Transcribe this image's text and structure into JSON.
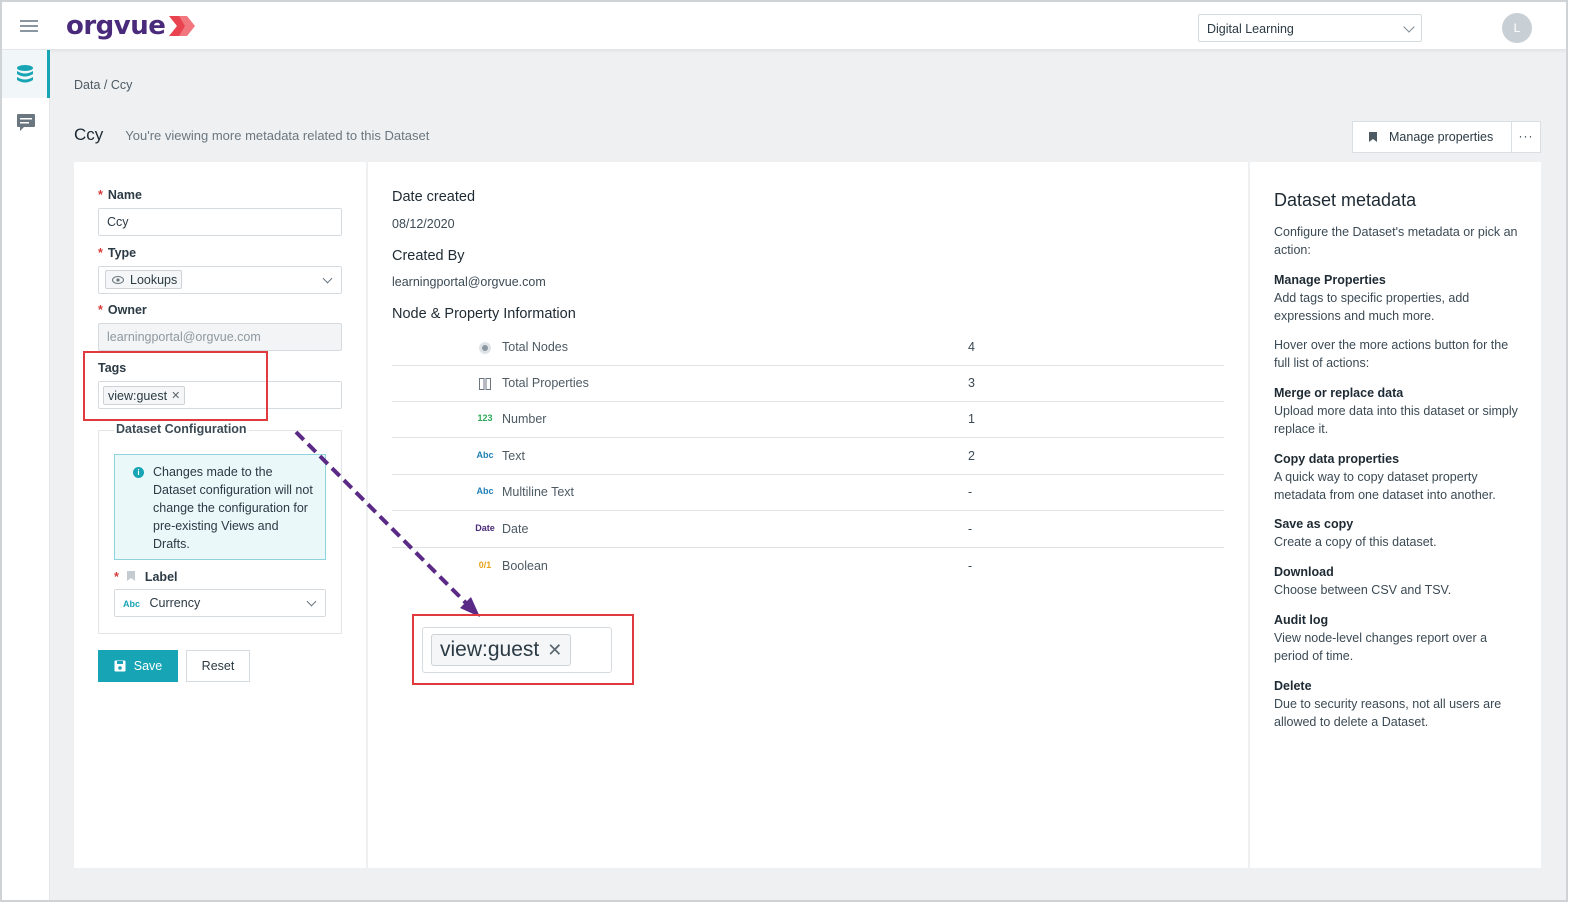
{
  "app": {
    "brand": "orgvue",
    "workspace": "Digital Learning",
    "avatar_initial": "L"
  },
  "breadcrumb": "Data / Ccy",
  "page": {
    "title": "Ccy",
    "subtitle": "You're viewing more metadata related to this Dataset"
  },
  "actions": {
    "manage_properties": "Manage properties",
    "more": "···"
  },
  "form": {
    "name_label": "Name",
    "name_value": "Ccy",
    "type_label": "Type",
    "type_value": "Lookups",
    "owner_label": "Owner",
    "owner_value": "learningportal@orgvue.com",
    "tags_label": "Tags",
    "tag_value": "view:guest",
    "ds_config_title": "Dataset Configuration",
    "info_text": "Changes made to the Dataset configuration will not change the configuration for pre-existing Views and Drafts.",
    "label_label": "Label",
    "label_type": "Abc",
    "label_value": "Currency",
    "save": "Save",
    "reset": "Reset"
  },
  "details": {
    "date_created_label": "Date created",
    "date_created": "08/12/2020",
    "created_by_label": "Created By",
    "created_by": "learningportal@orgvue.com",
    "node_info_label": "Node & Property Information",
    "rows": [
      {
        "icon": "node-icon",
        "name": "Total Nodes",
        "value": "4"
      },
      {
        "icon": "columns-icon",
        "name": "Total Properties",
        "value": "3"
      },
      {
        "icon": "number-type-icon",
        "icon_text": "123",
        "name": "Number",
        "value": "1"
      },
      {
        "icon": "text-type-icon",
        "icon_text": "Abc",
        "name": "Text",
        "value": "2"
      },
      {
        "icon": "multiline-text-type-icon",
        "icon_text": "Abc",
        "name": "Multiline Text",
        "value": "-"
      },
      {
        "icon": "date-type-icon",
        "icon_text": "Date",
        "name": "Date",
        "value": "-"
      },
      {
        "icon": "boolean-type-icon",
        "icon_text": "0/1",
        "name": "Boolean",
        "value": "-"
      }
    ]
  },
  "help": {
    "title": "Dataset metadata",
    "intro": "Configure the Dataset's metadata or pick an action:",
    "items": [
      {
        "heading": "Manage Properties",
        "text": "Add tags to specific properties, add expressions and much more."
      },
      {
        "heading": "",
        "text": "Hover over the more actions button for the full list of actions:"
      },
      {
        "heading": "Merge or replace data",
        "text": "Upload more data into this dataset or simply replace it."
      },
      {
        "heading": "Copy data properties",
        "text": "A quick way to copy dataset property metadata from one dataset into another."
      },
      {
        "heading": "Save as copy",
        "text": "Create a copy of this dataset."
      },
      {
        "heading": "Download",
        "text": "Choose between CSV and TSV."
      },
      {
        "heading": "Audit log",
        "text": "View node-level changes report over a period of time."
      },
      {
        "heading": "Delete",
        "text": "Due to security reasons, not all users are allowed to delete a Dataset."
      }
    ]
  },
  "colors": {
    "accent": "#17a4b4",
    "brand": "#4a2a7a",
    "annotation": "#e0393e",
    "arrow": "#5a2a86"
  }
}
